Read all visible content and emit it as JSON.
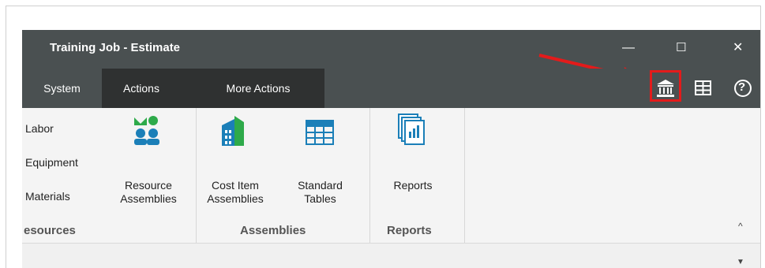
{
  "window": {
    "title": "Training Job - Estimate"
  },
  "window_controls": {
    "minimize": "—",
    "maximize": "☐",
    "close": "✕"
  },
  "tabs": [
    {
      "label": "System"
    },
    {
      "label": "Actions"
    },
    {
      "label": "More Actions"
    }
  ],
  "toolbar_icons": [
    "bank-icon",
    "grid-icon",
    "help-icon"
  ],
  "help_glyph": "?",
  "ribbon": {
    "resources": {
      "items": [
        "Labor",
        "Equipment",
        "Materials"
      ],
      "resource_assemblies_label_line1": "Resource",
      "resource_assemblies_label_line2": "Assemblies",
      "group_label": "esources"
    },
    "assemblies": {
      "cost_item_line1": "Cost Item",
      "cost_item_line2": "Assemblies",
      "standard_tables_line1": "Standard",
      "standard_tables_line2": "Tables",
      "group_label": "Assemblies"
    },
    "reports": {
      "reports_label": "Reports",
      "group_label": "Reports"
    },
    "collapse_glyph": "^"
  },
  "colors": {
    "titlebar": "#4a5051",
    "active_tab": "#2f3131",
    "highlight": "#e31b1b",
    "arrow": "#e31b1b"
  }
}
